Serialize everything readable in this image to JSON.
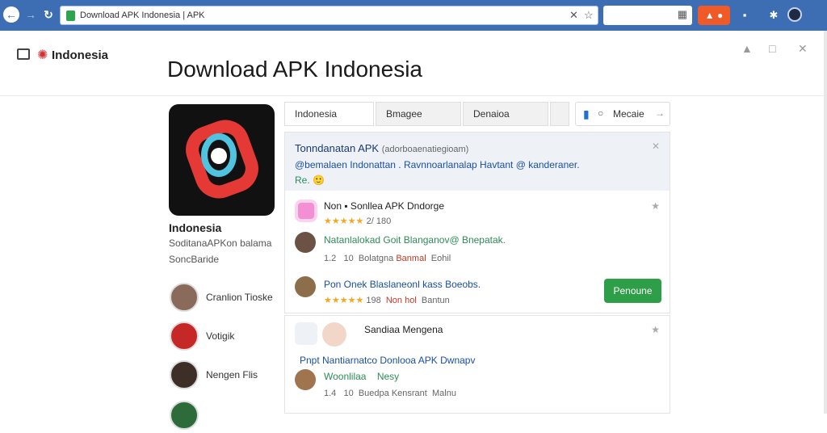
{
  "browser": {
    "url": "Download APK Indonesia | APK",
    "back_icon": "arrow-left-icon",
    "forward_icon": "arrow-right-icon",
    "reload_icon": "reload-icon"
  },
  "header": {
    "logo_text": "Indonesia",
    "title": "Download APK Indonesia"
  },
  "app": {
    "name": "Indonesia",
    "subtitle": "SoditanaAPKon balama",
    "subtitle2": "SoncBaride"
  },
  "sidebar": {
    "items": [
      {
        "label": "Cranlion Tioske"
      },
      {
        "label": "Votigik"
      },
      {
        "label": "Nengen Flis"
      },
      {
        "label": ""
      }
    ]
  },
  "tabs": [
    {
      "label": "Indonesia"
    },
    {
      "label": "Bmagee"
    },
    {
      "label": "Denaioa"
    },
    {
      "label": ""
    }
  ],
  "filter": {
    "label": "Mecaie"
  },
  "feature": {
    "title": "Tonndanatan APK",
    "title_meta": "(adorboaenatiegioam)",
    "desc": "@bemalaen Indonattan . Ravnnoarlanalap Havtant @ kanderaner.",
    "desc2": "Re. 🙂"
  },
  "post1": {
    "title": "Non  ▪ Sonllea APK Dndorge",
    "rating": "2/ 180",
    "comment1": "Natanlalokad Goit Blanganov@ Bnepatak.",
    "meta1_a": "1.2",
    "meta1_b": "10",
    "meta1_c": "Bolatgna",
    "meta1_d": "Banmal",
    "meta1_e": "Eohil",
    "comment2": "Pon Onek Blaslaneonl kass Boeobs.",
    "meta2_a": "198",
    "meta2_b": "Non hol",
    "meta2_c": "Bantun",
    "button": "Penoune"
  },
  "post2": {
    "title": "Sandiaa Mengena",
    "line1": "Pnpt Nantiarnatco Donlooa APK Dwnapv",
    "line2": "Woonlilaa",
    "line2b": "Nesy",
    "meta_a": "1.4",
    "meta_b": "10",
    "meta_c": "Buedpa Kensrant",
    "meta_d": "Malnu"
  }
}
